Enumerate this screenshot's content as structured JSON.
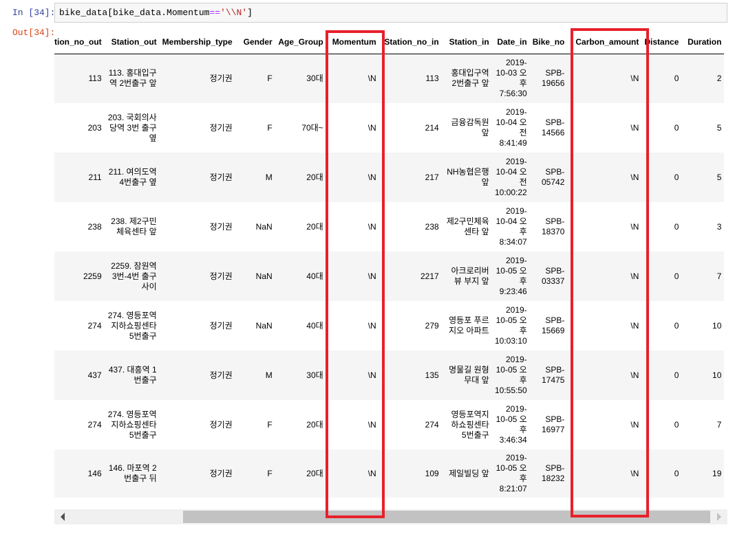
{
  "input_prompt": "In [34]:",
  "output_prompt": "Out[34]:",
  "code": {
    "prefix": "bike_data[bike_data.Momentum",
    "operator": "==",
    "string": "'\\\\N'",
    "suffix": "]"
  },
  "table": {
    "columns": [
      "tion_no_out",
      "Station_out",
      "Membership_type",
      "Gender",
      "Age_Group",
      "Momentum",
      "Station_no_in",
      "Station_in",
      "Date_in",
      "Bike_no",
      "Carbon_amount",
      "Distance",
      "Duration"
    ],
    "rows": [
      [
        "113",
        "113. 홍대입구역 2번출구 앞",
        "정기권",
        "F",
        "30대",
        "\\N",
        "113",
        "홍대입구역 2번출구 앞",
        "2019-10-03 오후 7:56:30",
        "SPB-19656",
        "\\N",
        "0",
        "2"
      ],
      [
        "203",
        "203. 국회의사당역 3번 출구 옆",
        "정기권",
        "F",
        "70대~",
        "\\N",
        "214",
        "금융감독원 앞",
        "2019-10-04 오전 8:41:49",
        "SPB-14566",
        "\\N",
        "0",
        "5"
      ],
      [
        "211",
        "211. 여의도역 4번출구 옆",
        "정기권",
        "M",
        "20대",
        "\\N",
        "217",
        "NH농협은행 앞",
        "2019-10-04 오전 10:00:22",
        "SPB-05742",
        "\\N",
        "0",
        "5"
      ],
      [
        "238",
        "238. 제2구민체육센타 앞",
        "정기권",
        "NaN",
        "20대",
        "\\N",
        "238",
        "제2구민체육센타 앞",
        "2019-10-04 오후 8:34:07",
        "SPB-18370",
        "\\N",
        "0",
        "3"
      ],
      [
        "2259",
        "2259. 잠원역 3번-4번 출구사이",
        "정기권",
        "NaN",
        "40대",
        "\\N",
        "2217",
        "아크로리버뷰 부지 앞",
        "2019-10-05 오후 9:23:46",
        "SPB-03337",
        "\\N",
        "0",
        "7"
      ],
      [
        "274",
        "274. 영등포역지하쇼핑센타 5번출구",
        "정기권",
        "NaN",
        "40대",
        "\\N",
        "279",
        "영등포 푸르지오 아파트",
        "2019-10-05 오후 10:03:10",
        "SPB-15669",
        "\\N",
        "0",
        "10"
      ],
      [
        "437",
        "437. 대흥역 1번출구",
        "정기권",
        "M",
        "30대",
        "\\N",
        "135",
        "명물길 원형무대 앞",
        "2019-10-05 오후 10:55:50",
        "SPB-17475",
        "\\N",
        "0",
        "10"
      ],
      [
        "274",
        "274. 영등포역지하쇼핑센타 5번출구",
        "정기권",
        "F",
        "20대",
        "\\N",
        "274",
        "영등포역지하쇼핑센타 5번출구",
        "2019-10-05 오후 3:46:34",
        "SPB-16977",
        "\\N",
        "0",
        "7"
      ],
      [
        "146",
        "146. 마포역 2번출구 뒤",
        "정기권",
        "F",
        "20대",
        "\\N",
        "109",
        "제일빌딩 앞",
        "2019-10-05 오후 8:21:07",
        "SPB-18232",
        "\\N",
        "0",
        "19"
      ]
    ]
  },
  "colors": {
    "highlight": "#e8202a",
    "input_prompt": "#303f9f",
    "output_prompt": "#d84315"
  }
}
